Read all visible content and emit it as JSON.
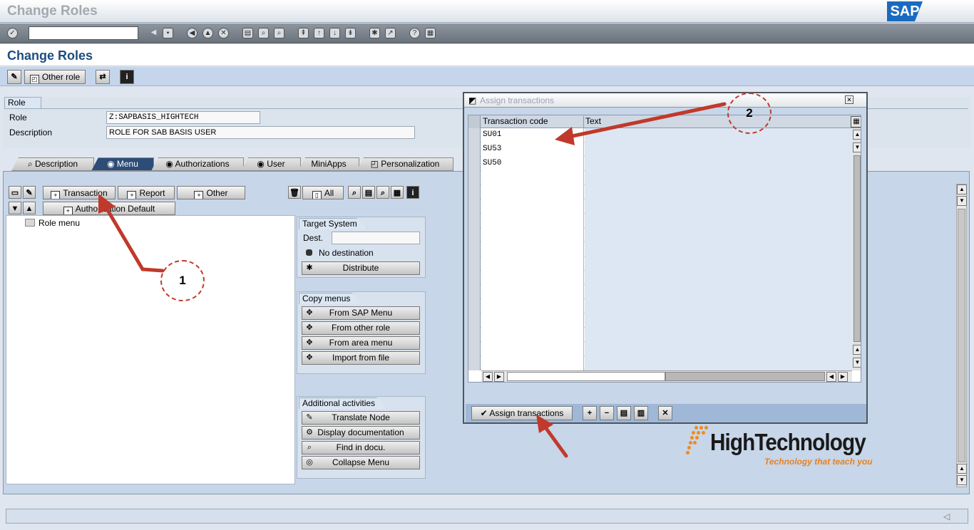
{
  "window": {
    "title": "Change Roles",
    "logo": "SAP"
  },
  "toolbar": {
    "command_value": "",
    "icons": [
      "enter-icon",
      "back-icon",
      "save-icon",
      "exit-icon",
      "cancel-icon",
      "print-icon",
      "find-icon",
      "find-next-icon",
      "first-page-icon",
      "prev-page-icon",
      "next-page-icon",
      "last-page-icon",
      "new-session-icon",
      "shortcut-icon",
      "help-icon",
      "layout-icon"
    ]
  },
  "page": {
    "title": "Change Roles"
  },
  "app_toolbar": {
    "other_role_label": "Other role"
  },
  "role_group": {
    "header": "Role",
    "role_label": "Role",
    "role_value": "Z:SAPBASIS_HIGHTECH",
    "description_label": "Description",
    "description_value": "ROLE FOR SAB BASIS USER"
  },
  "tabs": [
    {
      "label": "Description"
    },
    {
      "label": "Menu",
      "active": true
    },
    {
      "label": "Authorizations"
    },
    {
      "label": "User"
    },
    {
      "label": "MiniApps"
    },
    {
      "label": "Personalization"
    }
  ],
  "menu_toolbar": {
    "transaction": "Transaction",
    "report": "Report",
    "other": "Other",
    "all": "All",
    "authorization_default": "Authorization Default"
  },
  "menu_tree": {
    "root": "Role menu"
  },
  "target_system": {
    "header": "Target System",
    "dest_label": "Dest.",
    "dest_value": "",
    "status": "No destination",
    "distribute": "Distribute"
  },
  "copy_menus": {
    "header": "Copy menus",
    "buttons": [
      "From SAP Menu",
      "From other role",
      "From area menu",
      "Import from file"
    ]
  },
  "additional_activities": {
    "header": "Additional activities",
    "buttons": [
      "Translate Node",
      "Display documentation",
      "Find in docu.",
      "Collapse Menu"
    ]
  },
  "dialog": {
    "title": "Assign transactions",
    "columns": [
      "Transaction code",
      "Text"
    ],
    "rows": [
      {
        "code": "SU01",
        "text": ""
      },
      {
        "code": "SU53",
        "text": ""
      },
      {
        "code": "SU50",
        "text": ""
      }
    ],
    "assign_button": "Assign transactions"
  },
  "annotations": [
    "1",
    "2"
  ],
  "brand": {
    "name": "HighTechnology",
    "tagline": "Technology that teach you"
  },
  "colors": {
    "arrow": "#c0392b",
    "brand_orange": "#f08a1e",
    "tab_active": "#2d4d77",
    "page_title": "#1d4e80"
  }
}
